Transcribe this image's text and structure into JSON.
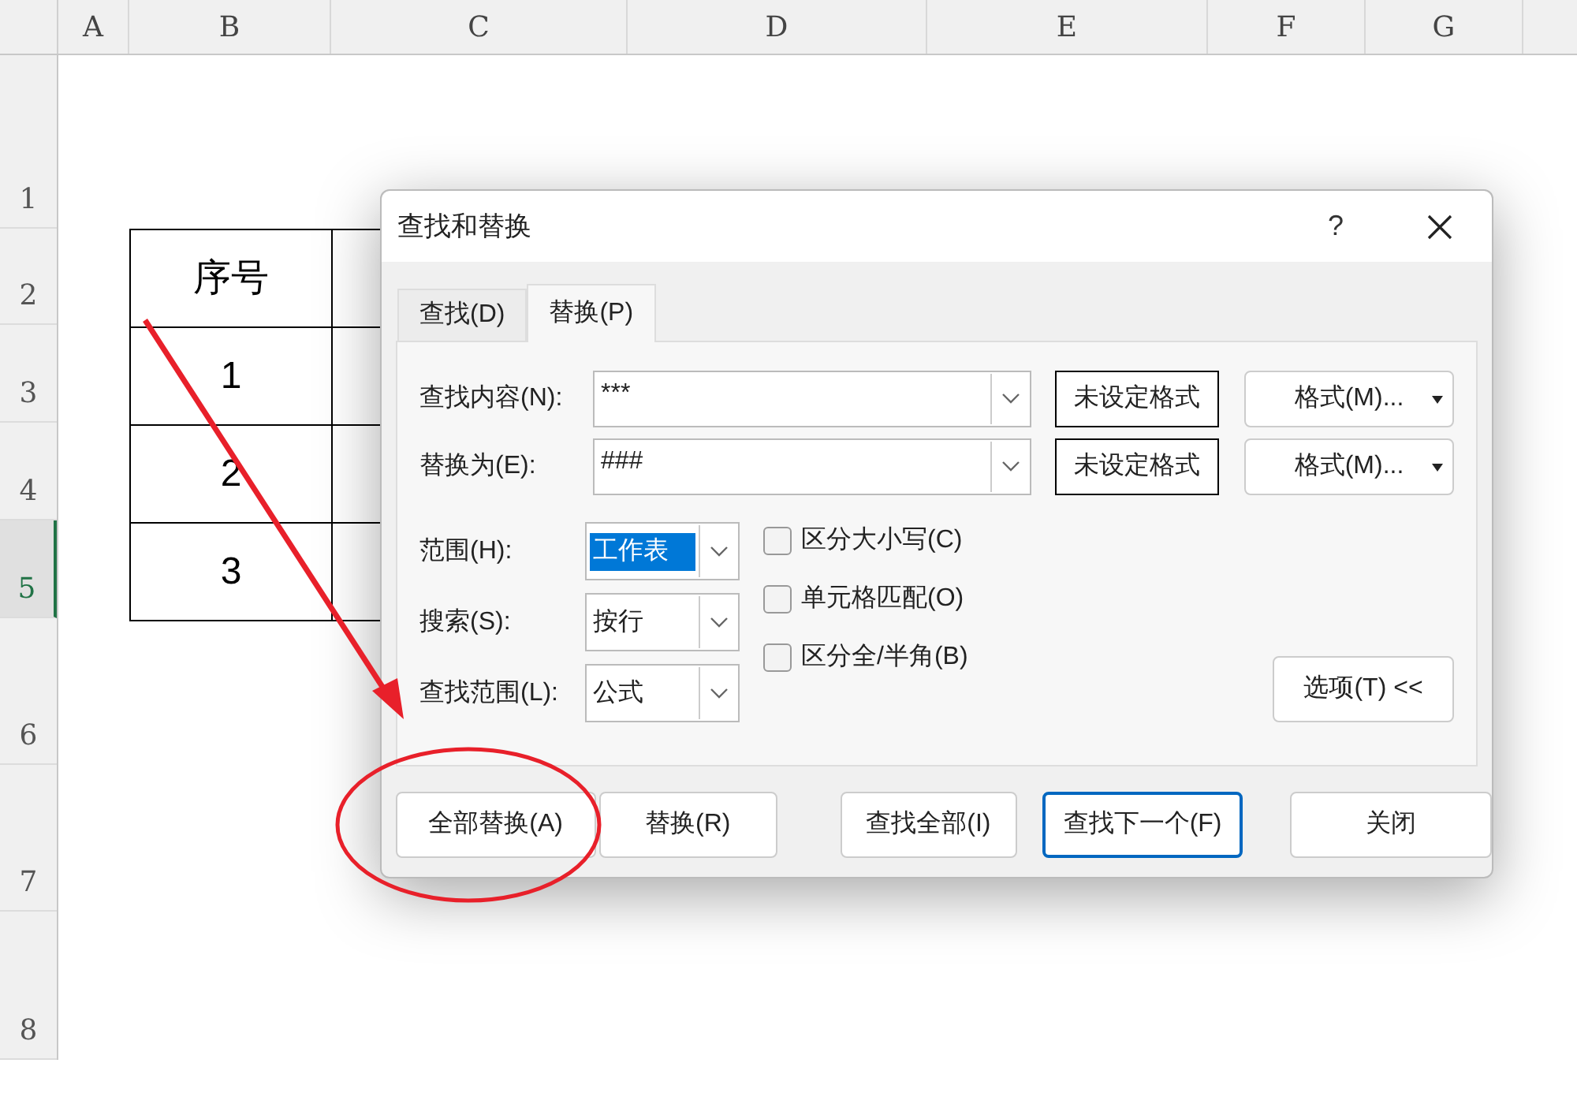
{
  "sheet": {
    "columns": [
      "A",
      "B",
      "C",
      "D",
      "E",
      "F",
      "G"
    ],
    "rows": [
      {
        "label": "1",
        "selected": false
      },
      {
        "label": "2",
        "selected": false
      },
      {
        "label": "3",
        "selected": false
      },
      {
        "label": "4",
        "selected": false
      },
      {
        "label": "5",
        "selected": true
      },
      {
        "label": "6",
        "selected": false
      },
      {
        "label": "7",
        "selected": false
      },
      {
        "label": "8",
        "selected": false
      }
    ],
    "cells": [
      "序号",
      "1",
      "2",
      "3"
    ]
  },
  "dialog": {
    "title": "查找和替换",
    "help": "?",
    "tabs": [
      {
        "label": "查找(D)",
        "selected": false
      },
      {
        "label": "替换(P)",
        "selected": true
      }
    ],
    "fields": [
      {
        "label": "查找内容(N):",
        "value": "***",
        "format_status": "未设定格式",
        "format_button": "格式(M)..."
      },
      {
        "label": "替换为(E):",
        "value": "###",
        "format_status": "未设定格式",
        "format_button": "格式(M)..."
      }
    ],
    "selects": [
      {
        "label": "范围(H):",
        "value": "工作表",
        "text_selected": true
      },
      {
        "label": "搜索(S):",
        "value": "按行",
        "text_selected": false
      },
      {
        "label": "查找范围(L):",
        "value": "公式",
        "text_selected": false
      }
    ],
    "checkboxes": [
      {
        "label": "区分大小写(C)",
        "checked": false
      },
      {
        "label": "单元格匹配(O)",
        "checked": false
      },
      {
        "label": "区分全/半角(B)",
        "checked": false
      }
    ],
    "options_button": "选项(T) <<",
    "buttons": [
      {
        "label": "全部替换(A)",
        "default": false
      },
      {
        "label": "替换(R)",
        "default": false
      },
      {
        "label": "查找全部(I)",
        "default": false
      },
      {
        "label": "查找下一个(F)",
        "default": true
      },
      {
        "label": "关闭",
        "default": false
      }
    ]
  }
}
